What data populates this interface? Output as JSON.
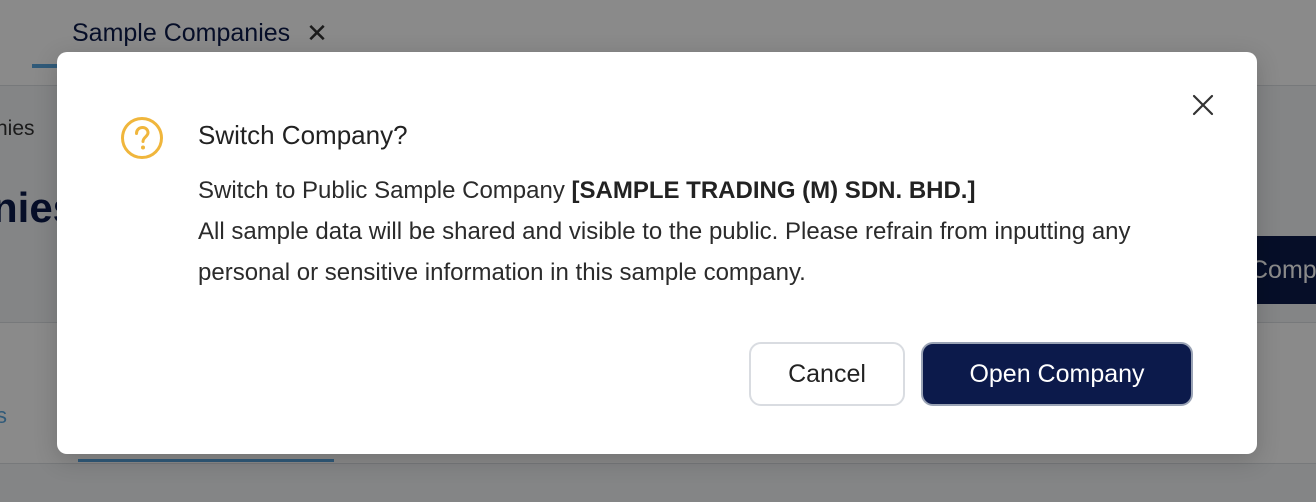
{
  "background": {
    "tab_label": "Sample Companies",
    "breadcrumb": "nies",
    "page_title": "nies",
    "primary_button": "Comp",
    "card_tab": "s"
  },
  "dialog": {
    "title": "Switch Company?",
    "line1_prefix": "Switch to Public Sample Company ",
    "company_name": "[SAMPLE TRADING (M) SDN. BHD.]",
    "line2": "All sample data will be shared and visible to the public. Please refrain from inputting any personal or sensitive information in this sample company.",
    "cancel_label": "Cancel",
    "open_label": "Open Company",
    "icon": "question-circle-icon",
    "close_icon": "close-icon"
  },
  "colors": {
    "brand_navy": "#0c1a4b",
    "accent_blue": "#5aa6e0",
    "warning_icon": "#f0b63c"
  }
}
